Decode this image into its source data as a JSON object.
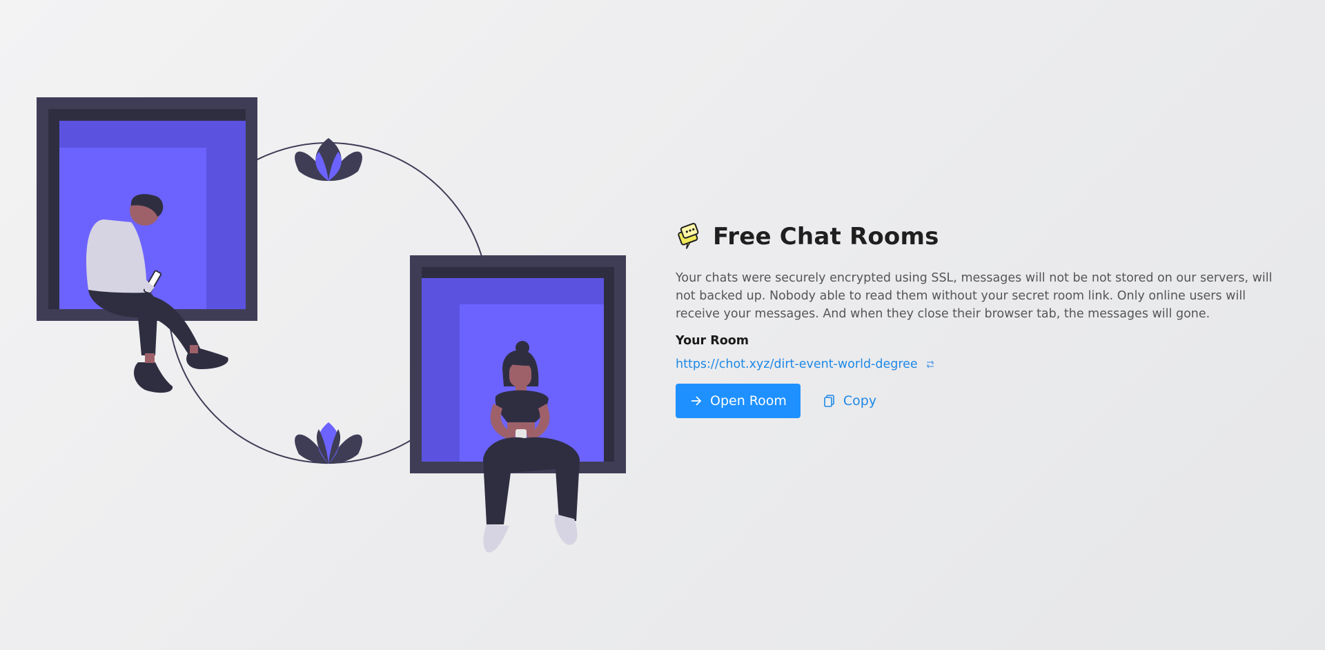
{
  "app": {
    "title": "Free Chat Rooms",
    "logo_icon": "chat-rooms-logo-icon"
  },
  "description": "Your chats were securely encrypted using SSL, messages will not be not stored on our servers, will not backed up. Nobody able to read them without your secret room link. Only online users will receive your messages. And when they close their browser tab, the messages will gone.",
  "room": {
    "label": "Your Room",
    "link": "https://chot.xyz/dirt-event-world-degree",
    "refresh_icon": "refresh-icon"
  },
  "actions": {
    "open_label": "Open Room",
    "open_icon": "arrow-right-icon",
    "copy_label": "Copy",
    "copy_icon": "copy-icon"
  },
  "colors": {
    "primary": "#1e90ff",
    "link": "#1e88e5",
    "illustration_purple": "#6c63ff",
    "frame_dark": "#3f3d56"
  }
}
